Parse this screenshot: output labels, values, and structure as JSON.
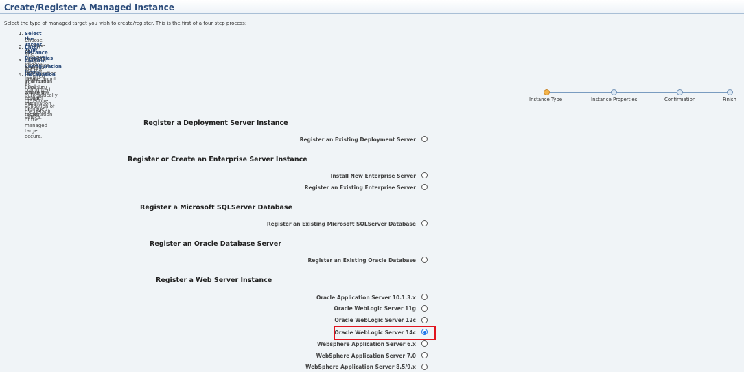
{
  "header": {
    "title": "Create/Register A Managed Instance"
  },
  "intro": "Select the type of managed target you wish to create/register. This is the first of a four step process:",
  "steps": [
    {
      "num": "1.",
      "title": "Select the Target Type",
      "desc": "Choose the type of managed target you wish to create."
    },
    {
      "num": "2.",
      "title": "Enter Instance Properties",
      "desc": "The instance properties are the required information used to create or register the managed target."
    },
    {
      "num": "3.",
      "title": "Confirm Configuration Items",
      "desc": "Some configuration items cannot be configured automatically or require validation of the default values."
    },
    {
      "num": "4.",
      "title": "Installation",
      "desc": "This is the final step where the actual installation or registration of the managed target occurs."
    }
  ],
  "train": {
    "stops": [
      "Instance Type",
      "Instance Properties",
      "Confirmation",
      "Finish"
    ],
    "current": "Instance Type"
  },
  "sections": [
    {
      "title": "Register a Deployment Server Instance",
      "options": [
        {
          "label": "Register an Existing Deployment Server",
          "checked": false
        }
      ]
    },
    {
      "title": "Register or Create an Enterprise Server Instance",
      "options": [
        {
          "label": "Install New Enterprise Server",
          "checked": false
        },
        {
          "label": "Register an Existing Enterprise Server",
          "checked": false
        }
      ]
    },
    {
      "title": "Register a Microsoft SQLServer Database",
      "options": [
        {
          "label": "Register an Existing Microsoft SQLServer Database",
          "checked": false
        }
      ]
    },
    {
      "title": "Register an Oracle Database Server",
      "options": [
        {
          "label": "Register an Existing Oracle Database",
          "checked": false
        }
      ]
    },
    {
      "title": "Register a Web Server Instance",
      "options": [
        {
          "label": "Oracle Application Server 10.1.3.x",
          "checked": false
        },
        {
          "label": "Oracle WebLogic Server 11g",
          "checked": false
        },
        {
          "label": "Oracle WebLogic Server 12c",
          "checked": false
        },
        {
          "label": "Oracle WebLogic Server 14c",
          "checked": true
        },
        {
          "label": "Websphere Application Server 6.x",
          "checked": false
        },
        {
          "label": "WebSphere Application Server 7.0",
          "checked": false
        },
        {
          "label": "WebSphere Application Server 8.5/9.x",
          "checked": false
        }
      ]
    }
  ],
  "colors": {
    "title": "#2b4b7a",
    "highlight": "#e0141e",
    "selected": "#1a73e8"
  }
}
